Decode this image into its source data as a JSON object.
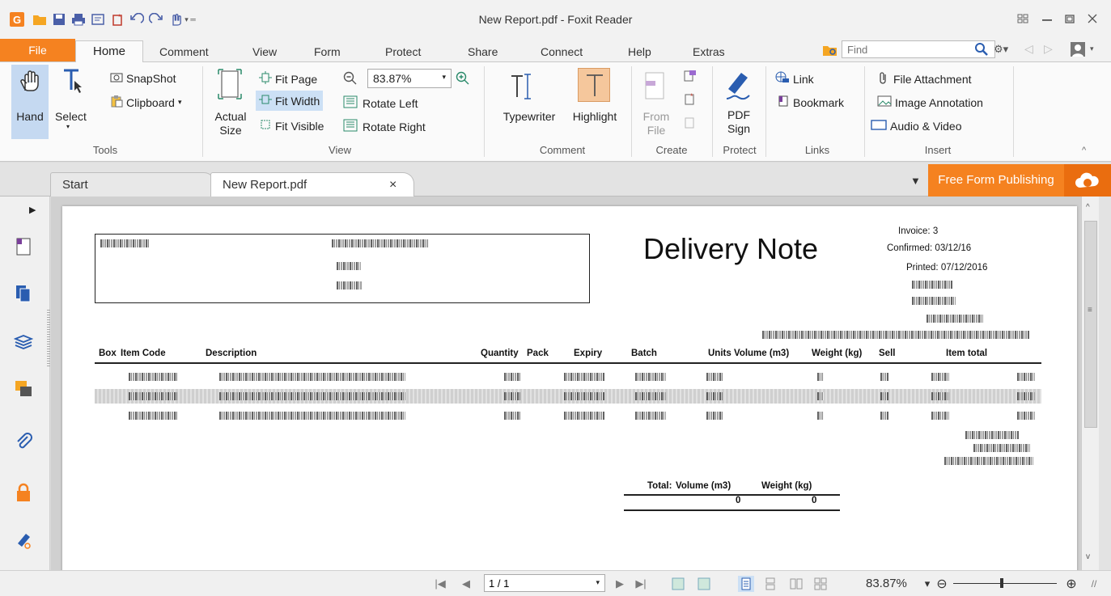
{
  "window": {
    "title": "New Report.pdf - Foxit Reader"
  },
  "menu": {
    "file": "File",
    "tabs": [
      "Home",
      "Comment",
      "View",
      "Form",
      "Protect",
      "Share",
      "Connect",
      "Help",
      "Extras"
    ]
  },
  "search": {
    "placeholder": "Find"
  },
  "ribbon": {
    "tools": {
      "hand": "Hand",
      "select": "Select",
      "snapshot": "SnapShot",
      "clipboard": "Clipboard",
      "group": "Tools"
    },
    "view": {
      "actual_size_1": "Actual",
      "actual_size_2": "Size",
      "fit_page": "Fit Page",
      "fit_width": "Fit Width",
      "fit_visible": "Fit Visible",
      "zoom_value": "83.87%",
      "rotate_left": "Rotate Left",
      "rotate_right": "Rotate Right",
      "group": "View"
    },
    "comment": {
      "typewriter": "Typewriter",
      "highlight": "Highlight",
      "group": "Comment"
    },
    "create": {
      "from_1": "From",
      "from_2": "File",
      "group": "Create"
    },
    "protect": {
      "pdf_1": "PDF",
      "pdf_2": "Sign",
      "group": "Protect"
    },
    "links": {
      "link": "Link",
      "bookmark": "Bookmark",
      "group": "Links"
    },
    "insert": {
      "file_attachment": "File Attachment",
      "image_annotation": "Image Annotation",
      "audio_video": "Audio & Video",
      "group": "Insert"
    }
  },
  "doc_tabs": {
    "start": "Start",
    "report": "New Report.pdf",
    "close": "×",
    "free_form": "Free Form Publishing"
  },
  "document": {
    "title": "Delivery Note",
    "invoice": "Invoice: 3",
    "confirmed": "Confirmed: 03/12/16",
    "printed": "Printed: 07/12/2016",
    "columns": [
      "Box",
      "Item Code",
      "Description",
      "Quantity",
      "Pack",
      "Expiry",
      "Batch",
      "Units",
      "Volume (m3)",
      "Weight (kg)",
      "Sell",
      "Item total"
    ],
    "totals": {
      "label": "Total:",
      "volume_label": "Volume (m3)",
      "weight_label": "Weight (kg)",
      "volume_value": "0",
      "weight_value": "0"
    }
  },
  "status": {
    "page": "1 / 1",
    "zoom": "83.87%"
  },
  "colors": {
    "accent": "#f58220",
    "fit_width_highlight": "#cce0f5",
    "hand_highlight": "#c5d9f1"
  }
}
